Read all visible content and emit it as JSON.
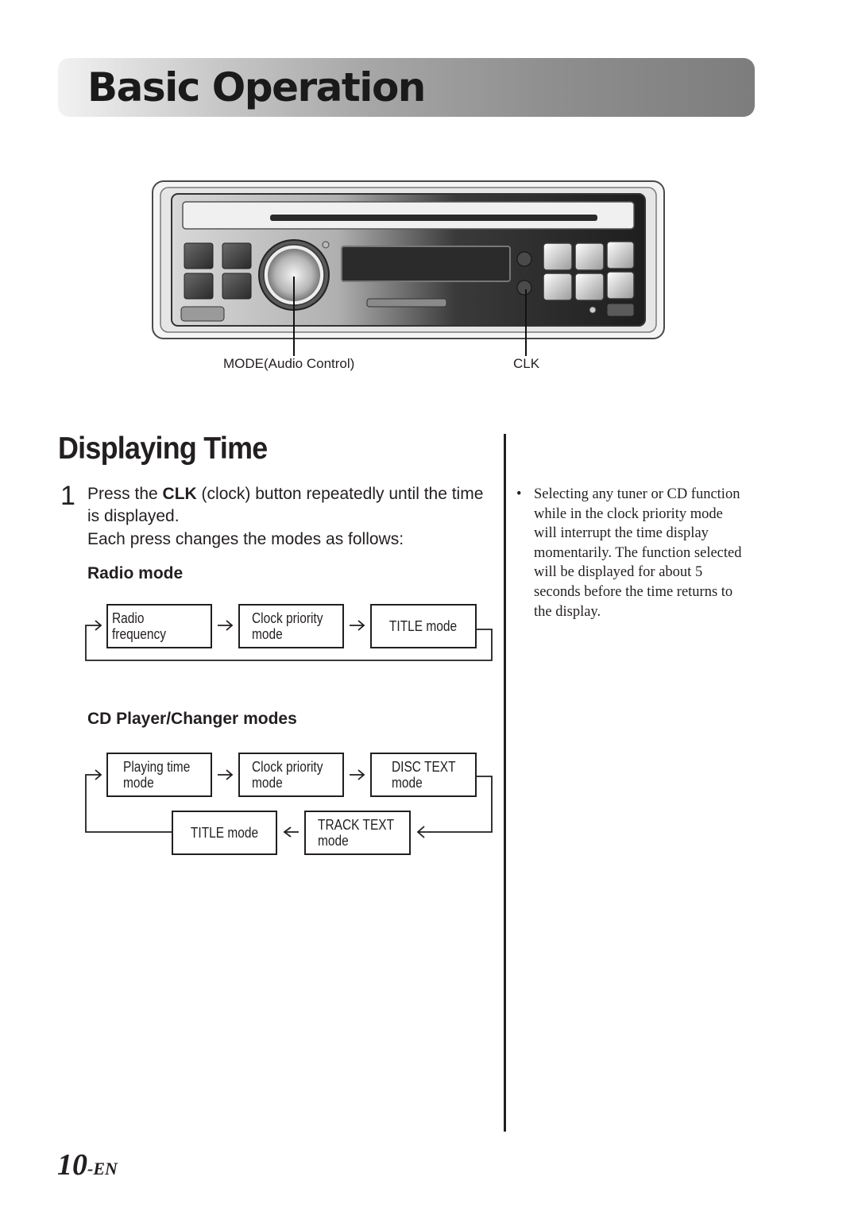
{
  "header": {
    "title": "Basic Operation"
  },
  "device": {
    "callouts": [
      {
        "id": "mode",
        "label": "MODE(Audio Control)"
      },
      {
        "id": "clk",
        "label": "CLK"
      }
    ]
  },
  "section": {
    "title": "Displaying Time",
    "step": {
      "number": "1",
      "text_before": "Press the ",
      "text_bold": "CLK",
      "text_after": " (clock) button repeatedly until the time is displayed.",
      "line2": "Each press changes the modes as follows:"
    },
    "radio": {
      "title": "Radio mode",
      "boxes": [
        "Radio frequency",
        "Clock priority\nmode",
        "TITLE mode"
      ]
    },
    "cd": {
      "title": "CD Player/Changer modes",
      "row1": [
        "Playing time\nmode",
        "Clock priority\nmode",
        "DISC TEXT\nmode"
      ],
      "row2": [
        "TITLE mode",
        "TRACK TEXT\nmode"
      ]
    }
  },
  "note": {
    "bullet": "•",
    "text": "Selecting any tuner or CD function while in the clock priority mode will interrupt the time display momentarily. The function selected will be displayed for about 5 seconds before the time returns to the display."
  },
  "footer": {
    "page_number": "10",
    "page_suffix": "-EN"
  }
}
